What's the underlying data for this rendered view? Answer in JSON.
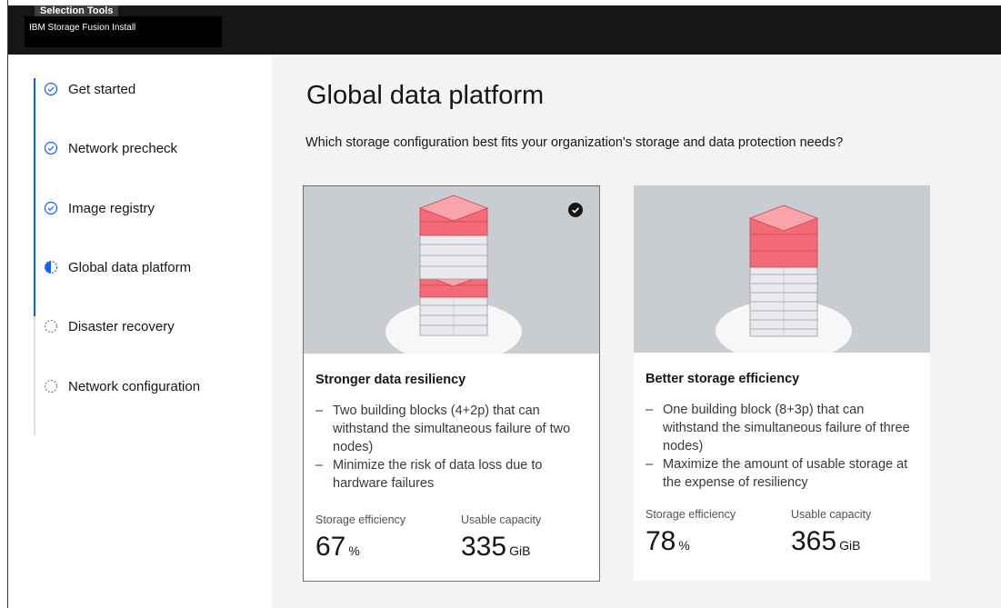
{
  "header": {
    "selection_tools": "Selection Tools",
    "app_title": "IBM Storage Fusion Install"
  },
  "progress": {
    "steps": [
      {
        "label": "Get started",
        "state": "complete"
      },
      {
        "label": "Network precheck",
        "state": "complete"
      },
      {
        "label": "Image registry",
        "state": "complete"
      },
      {
        "label": "Global data platform",
        "state": "current"
      },
      {
        "label": "Disaster recovery",
        "state": "incomplete"
      },
      {
        "label": "Network configuration",
        "state": "incomplete"
      }
    ]
  },
  "main": {
    "title": "Global data platform",
    "question": "Which storage configuration best fits your organization's storage and data protection needs?",
    "options": [
      {
        "title": "Stronger data resiliency",
        "selected": true,
        "bullets": [
          "Two building blocks (4+2p) that can withstand the simultaneous failure of two nodes)",
          "Minimize the risk of data loss due to hardware failures"
        ],
        "efficiency_label": "Storage efficiency",
        "efficiency_value": "67",
        "efficiency_unit": "%",
        "capacity_label": "Usable capacity",
        "capacity_value": "335",
        "capacity_unit": "GiB"
      },
      {
        "title": "Better storage efficiency",
        "selected": false,
        "bullets": [
          "One building block (8+3p) that can withstand the simultaneous failure of three nodes)",
          "Maximize the amount of usable storage at the expense of resiliency"
        ],
        "efficiency_label": "Storage efficiency",
        "efficiency_value": "78",
        "efficiency_unit": "%",
        "capacity_label": "Usable capacity",
        "capacity_value": "365",
        "capacity_unit": "GiB"
      }
    ]
  },
  "colors": {
    "accent": "#0f62fe",
    "block_red": "#f56a77",
    "block_gray": "#e6e6ea"
  },
  "icons": {
    "complete": "checkmark-outline-icon",
    "current": "half-circle-icon",
    "incomplete": "dashed-circle-icon",
    "selected": "checkmark-filled-icon"
  }
}
